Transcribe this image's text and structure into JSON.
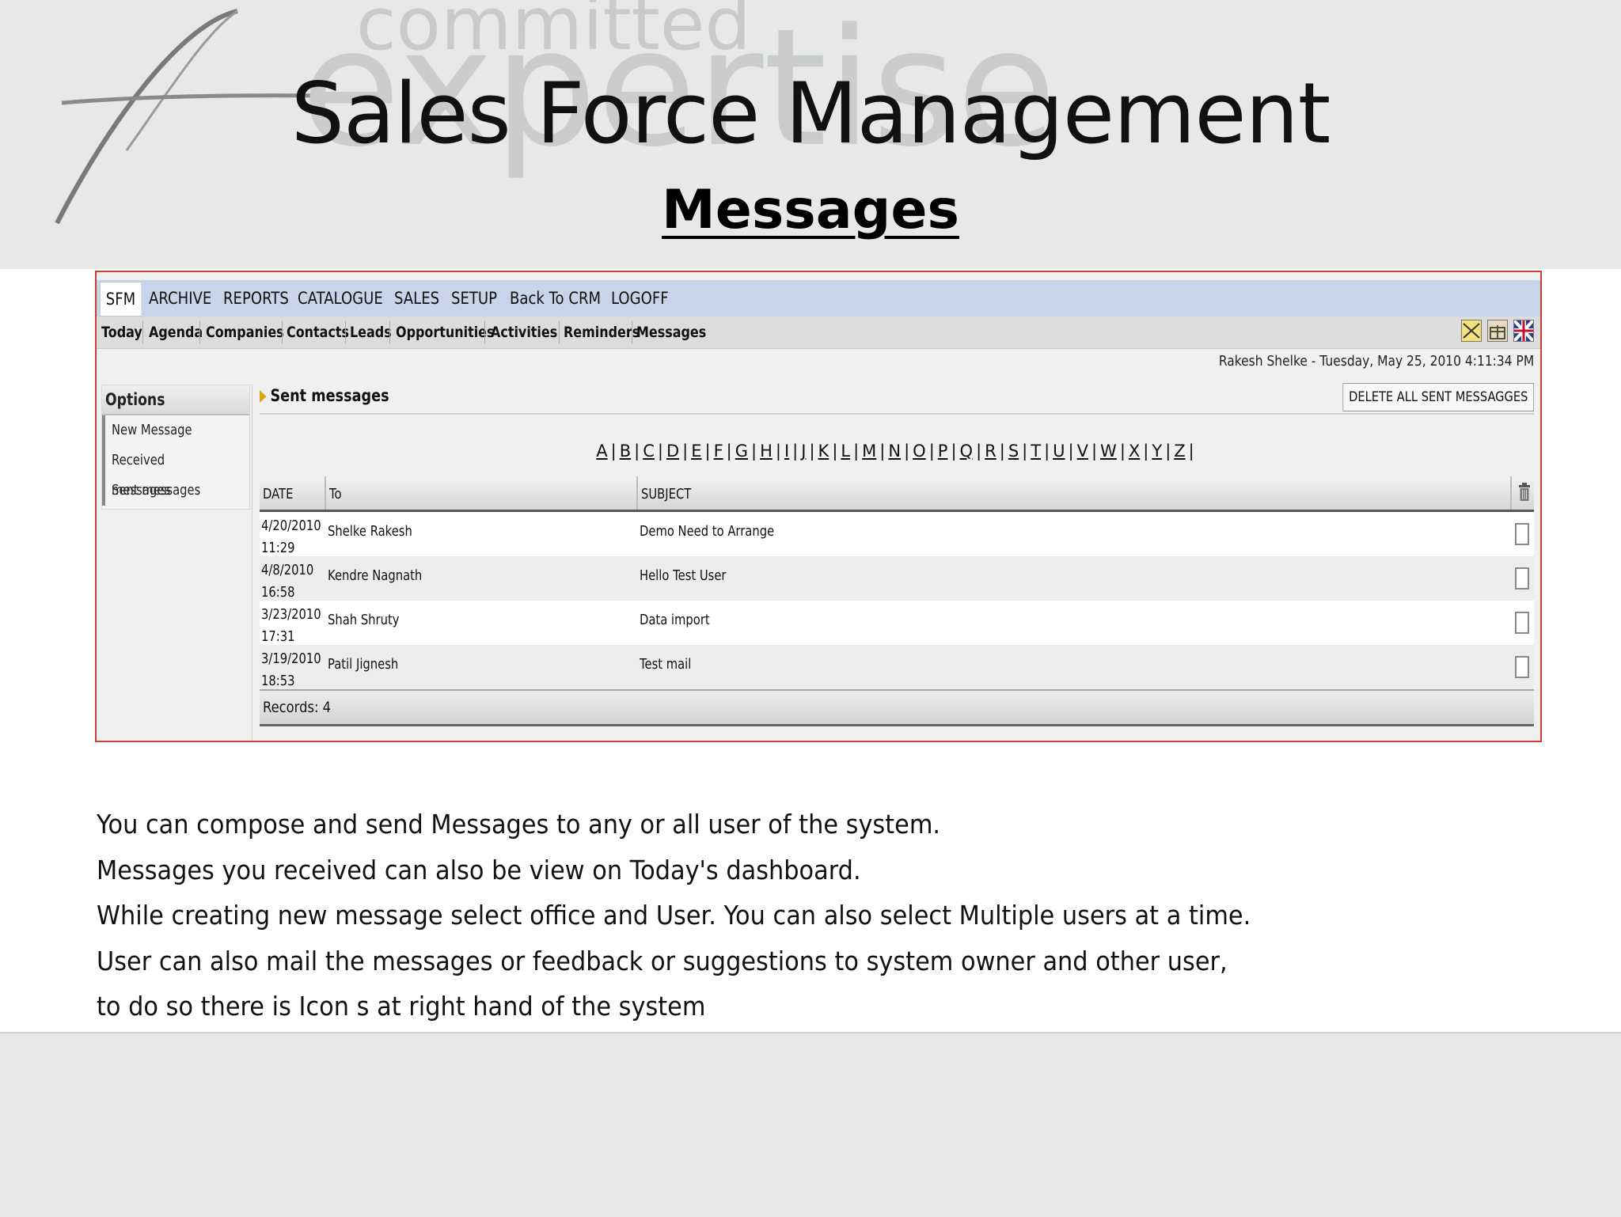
{
  "slide": {
    "title": "Sales Force Management",
    "subtitle": "Messages",
    "watermark_top": "committed",
    "watermark_main": "expertise"
  },
  "menu": [
    "SFM",
    "ARCHIVE",
    "REPORTS",
    "CATALOGUE",
    "SALES",
    "SETUP",
    "Back To CRM",
    "LOGOFF"
  ],
  "submenu": [
    "Today",
    "Agenda",
    "Companies",
    "Contacts",
    "Leads",
    "Opportunities",
    "Activities",
    "Reminders",
    "Messages"
  ],
  "user_line": "Rakesh Shelke - Tuesday, May 25, 2010 4:11:34 PM",
  "sidebar": {
    "title": "Options",
    "items": [
      "New Message",
      "Received messages",
      "Sent messages"
    ]
  },
  "section": {
    "title": "Sent messages",
    "delete_all": "DELETE ALL SENT MESSAGGES"
  },
  "alphabet": [
    "A",
    "B",
    "C",
    "D",
    "E",
    "F",
    "G",
    "H",
    "I",
    "J",
    "K",
    "L",
    "M",
    "N",
    "O",
    "P",
    "Q",
    "R",
    "S",
    "T",
    "U",
    "V",
    "W",
    "X",
    "Y",
    "Z"
  ],
  "table": {
    "headers": {
      "date": "DATE",
      "to": "To",
      "subject": "SUBJECT"
    },
    "rows": [
      {
        "date": "4/20/2010",
        "time": "11:29",
        "to": "Shelke Rakesh",
        "subject": "Demo Need to Arrange"
      },
      {
        "date": "4/8/2010",
        "time": "16:58",
        "to": "Kendre Nagnath",
        "subject": "Hello Test User"
      },
      {
        "date": "3/23/2010",
        "time": "17:31",
        "to": "Shah Shruty",
        "subject": "Data import"
      },
      {
        "date": "3/19/2010",
        "time": "18:53",
        "to": "Patil Jignesh",
        "subject": "Test mail"
      }
    ],
    "records": "Records: 4"
  },
  "notes": [
    "You can compose and send Messages to any or  all user of the system.",
    "Messages you received can  also be view on Today's dashboard.",
    "While creating new message select office and User. You can also select Multiple users at a time.",
    "User can also mail the messages or feedback or suggestions to system owner  and  other user,",
    "to do so there is Icon s at right hand of the system"
  ],
  "colors": {
    "accent_border": "#d33a3a",
    "menubar": "#c7d4ea",
    "arrow": "#d9a400"
  }
}
